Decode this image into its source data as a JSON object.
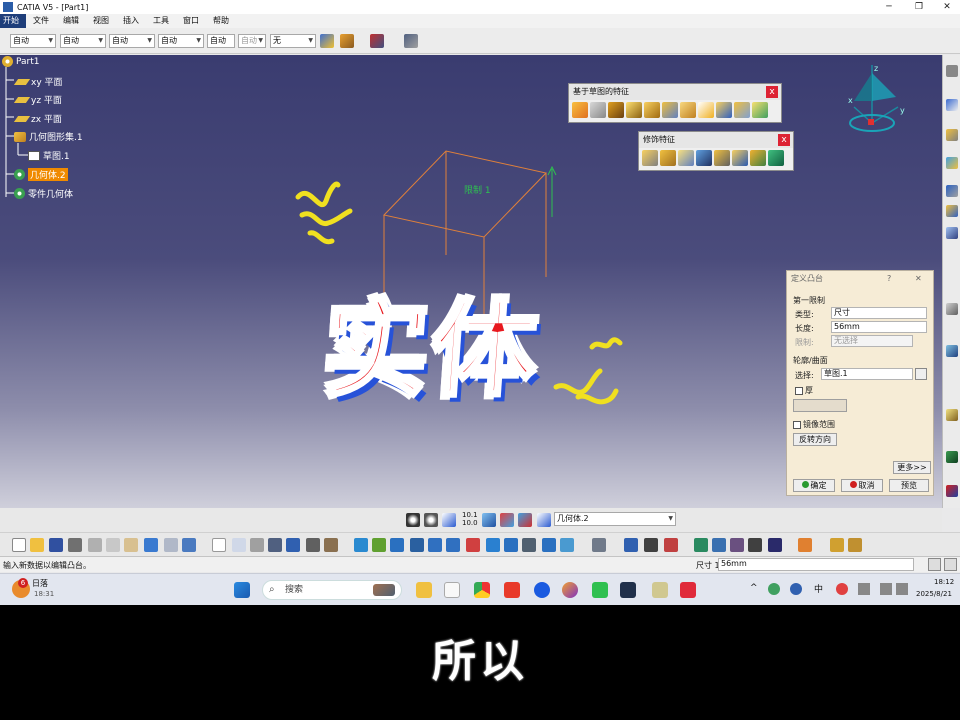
{
  "window": {
    "title": "CATIA V5 - [Part1]"
  },
  "menu": [
    "开始",
    "文件",
    "编辑",
    "视图",
    "插入",
    "工具",
    "窗口",
    "帮助"
  ],
  "top_toolbar": {
    "combos": [
      "自动",
      "自动",
      "自动",
      "自动",
      "自动",
      "自动",
      "无"
    ]
  },
  "tree": {
    "root": "Part1",
    "items": [
      "xy 平面",
      "yz 平面",
      "zx 平面",
      "几何图形集.1",
      "草图.1",
      "几何体.2",
      "零件几何体"
    ]
  },
  "viewport": {
    "limit_label": "限制 1",
    "compass": {
      "x": "x",
      "y": "y",
      "z": "z"
    }
  },
  "sketch_toolbar": {
    "title": "基于草图的特征",
    "close": "x"
  },
  "dress_toolbar": {
    "title": "修饰特征",
    "close": "x"
  },
  "overlay_text": "实体",
  "dialog": {
    "title": "定义凸台",
    "help": "?",
    "close": "✕",
    "first_limit": "第一限制",
    "type_label": "类型:",
    "type_value": "尺寸",
    "length_label": "长度:",
    "length_value": "56mm",
    "limit_label": "限制:",
    "limit_value": "无选择",
    "profile_section": "轮廓/曲面",
    "select_label": "选择:",
    "select_value": "草图.1",
    "thick_label": "厚",
    "mirror_label": "镜像范围",
    "reverse_button": "反转方向",
    "more_button": "更多>>",
    "ok_button": "确定",
    "cancel_button": "取消",
    "preview_button": "预览"
  },
  "bottom_toolbar": {
    "current_body": "几何体.2",
    "ratio_label_top": "10.1",
    "ratio_label_bottom": "10.0"
  },
  "status": {
    "message": "输入新数据以编辑凸台。",
    "field_label": "尺寸 1",
    "field_value": "56mm"
  },
  "taskbar": {
    "weather": "日落",
    "weather_time": "18:31",
    "badge": "6",
    "search_placeholder": "搜索",
    "ime": "中",
    "time": "18:12",
    "date": "2025/8/21"
  },
  "subtitle": "所以"
}
